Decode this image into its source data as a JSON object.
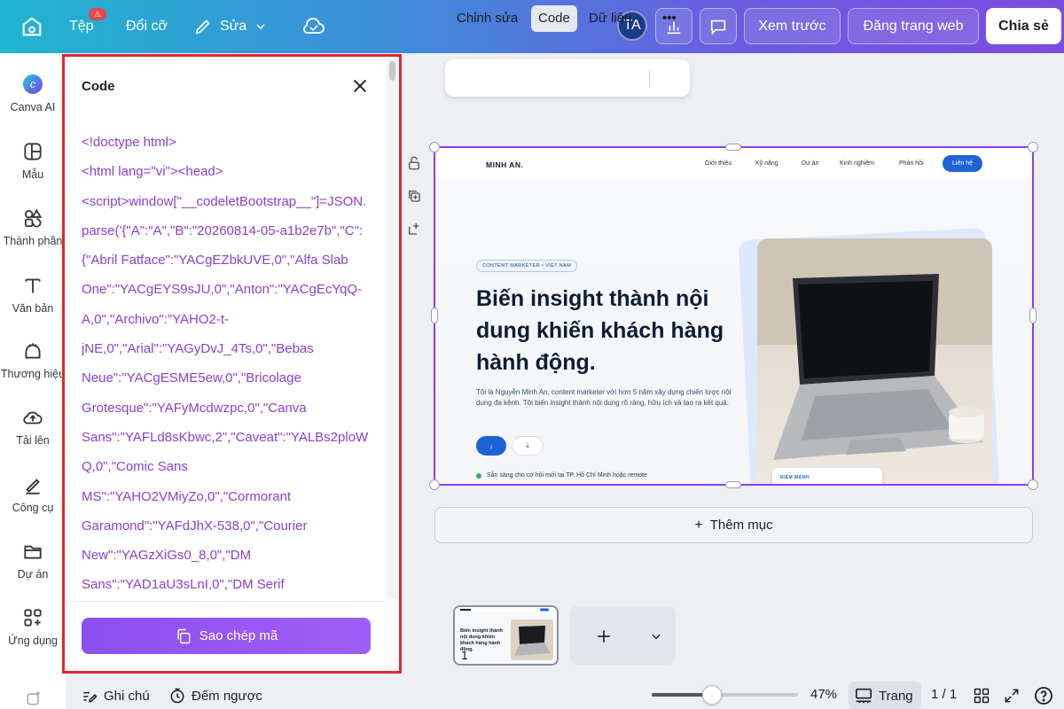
{
  "topbar": {
    "file_label": "Tệp",
    "file_badge": "",
    "resize_label": "Đổi cỡ",
    "edit_label": "Sửa",
    "avatar_initials": "TA",
    "preview_label": "Xem trước",
    "publish_label": "Đăng trang web",
    "share_label": "Chia sẻ"
  },
  "rail": {
    "items": [
      {
        "label": "Canva AI",
        "icon": "canva-ai-icon"
      },
      {
        "label": "Mẫu",
        "icon": "template-icon"
      },
      {
        "label": "Thành phần",
        "icon": "elements-icon"
      },
      {
        "label": "Văn bản",
        "icon": "text-icon"
      },
      {
        "label": "Thương hiệu",
        "icon": "brand-icon"
      },
      {
        "label": "Tải lên",
        "icon": "upload-icon"
      },
      {
        "label": "Công cụ",
        "icon": "tools-icon"
      },
      {
        "label": "Dự án",
        "icon": "folder-icon"
      },
      {
        "label": "Ứng dụng",
        "icon": "apps-icon"
      }
    ]
  },
  "code_panel": {
    "title": "Code",
    "lines": [
      "<!doctype html>",
      "<html lang=\"vi\"><head>",
      "<script>window[\"__codeletBootstrap__\"]=JSON.",
      "parse('{\"A\":\"A\",\"B\":\"20260814-05-a1b2e7b\",\"C\":",
      "{\"Abril Fatface\":\"YACgEZbkUVE,0\",\"Alfa Slab",
      "One\":\"YACgEYS9sJU,0\",\"Anton\":\"YACgEcYqQ-",
      "A,0\",\"Archivo\":\"YAHO2-t-",
      "jNE,0\",\"Arial\":\"YAGyDvJ_4Ts,0\",\"Bebas",
      "Neue\":\"YACgESME5ew,0\",\"Bricolage",
      "Grotesque\":\"YAFyMcdwzpc,0\",\"Canva",
      "Sans\":\"YAFLd8sKbwc,2\",\"Caveat\":\"YALBs2ploW",
      "Q,0\",\"Comic Sans",
      "MS\":\"YAHO2VMiyZo,0\",\"Cormorant",
      "Garamond\":\"YAFdJhX-538,0\",\"Courier",
      "New\":\"YAGzXiGs0_8,0\",\"DM",
      "Sans\":\"YAD1aU3sLnI,0\",\"DM Serif"
    ],
    "copy_label": "Sao chép mã"
  },
  "canvas_toolbar": {
    "edit_label": "Chỉnh sửa",
    "code_label": "Code",
    "data_label": "Dữ liệu",
    "more_label": "•••"
  },
  "website": {
    "logo": "MINH AN.",
    "nav": [
      "Giới thiệu",
      "Kỹ năng",
      "Dự án",
      "Kinh nghiệm",
      "Phản hồi"
    ],
    "contact_label": "Liên hệ",
    "tag": "CONTENT MARKETER • VIỆT NAM",
    "headline": "Biến insight thành nội dung khiến khách hàng hành động.",
    "paragraph": "Tôi là Nguyễn Minh An, content marketer với hơn 5 năm xây dựng chiến lược nội dung đa kênh. Tôi biến insight thành nội dung rõ ràng, hữu ích và tạo ra kết quả.",
    "btn1": "↓",
    "btn2": "⤓",
    "status": "Sẵn sàng cho cơ hội mới tại TP. Hồ Chí Minh hoặc remote",
    "card_label": "ĐIỂM MẠNH"
  },
  "add_section_label": "Thêm mục",
  "pages": {
    "thumb_number": "1",
    "thumb_title": "Biến insight thành nội dung khiến khách hàng hành động."
  },
  "bottombar": {
    "notes_label": "Ghi chú",
    "timer_label": "Đếm ngược",
    "zoom_percent": 47,
    "zoom_label": "47%",
    "pages_label": "Trang",
    "page_counter": "1 / 1"
  }
}
